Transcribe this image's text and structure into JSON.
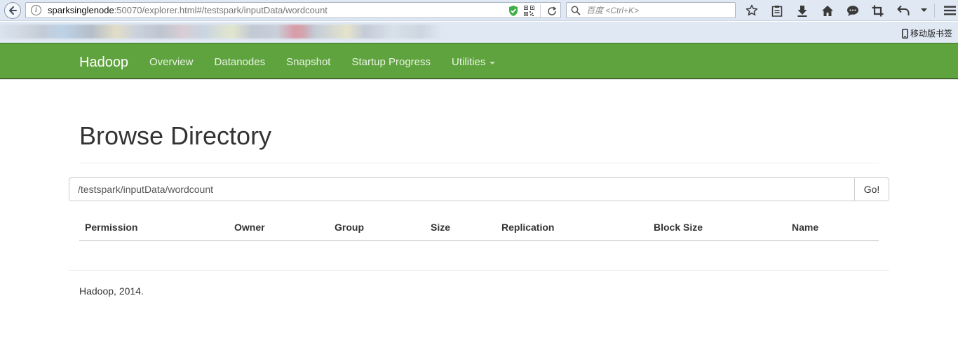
{
  "browser": {
    "url_host": "sparksinglenode",
    "url_rest": ":50070/explorer.html#/testspark/inputData/wordcount",
    "search_placeholder": "百度 <Ctrl+K>",
    "mobile_bookmarks": "移动版书签"
  },
  "navbar": {
    "brand": "Hadoop",
    "items": [
      {
        "label": "Overview"
      },
      {
        "label": "Datanodes"
      },
      {
        "label": "Snapshot"
      },
      {
        "label": "Startup Progress"
      },
      {
        "label": "Utilities"
      }
    ],
    "bg_color": "#5fa33e"
  },
  "main": {
    "title": "Browse Directory",
    "path_value": "/testspark/inputData/wordcount",
    "go_label": "Go!",
    "table": {
      "columns": [
        "Permission",
        "Owner",
        "Group",
        "Size",
        "Replication",
        "Block Size",
        "Name"
      ],
      "rows": []
    }
  },
  "footer": {
    "text": "Hadoop, 2014."
  }
}
